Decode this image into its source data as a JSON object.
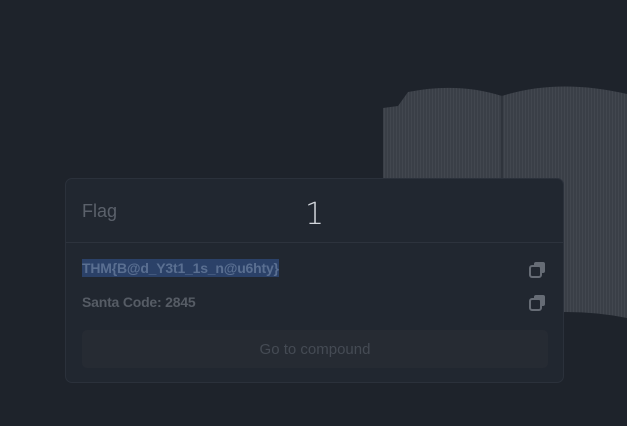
{
  "card": {
    "title": "Flag",
    "step_number": "1",
    "flag_value": "THM{B@d_Y3t1_1s_n@u6hty}",
    "santa_code_label": "Santa Code: 2845",
    "button_label": "Go to compound"
  },
  "icons": {
    "copy": "copy-icon",
    "background": "open-book-icon"
  },
  "colors": {
    "background": "#1e232b",
    "card": "#212730",
    "selection": "#2b4168"
  }
}
